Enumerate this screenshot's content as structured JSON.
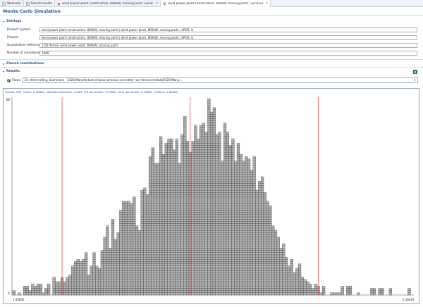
{
  "tabs": [
    {
      "label": "Welcome",
      "icon": "welcome-icon",
      "closable": false
    },
    {
      "label": "Search results",
      "icon": "search-results-icon",
      "closable": false
    },
    {
      "label": "wind power plant construction, 800kW, moving parts | wind power plant, 8...",
      "icon": "process-icon",
      "closable": true
    },
    {
      "label": "wind power plant construction, 800kW, moving parts | wind power plant, 8...",
      "icon": "product-system-icon",
      "closable": true,
      "active": true
    }
  ],
  "page_title": "Monte Carlo Simulation",
  "settings": {
    "header": "Settings",
    "fields": [
      {
        "label": "Product system",
        "value": "wind power plant construction, 800kW, moving parts | wind power plant, 800kW, moving parts | APOS, U"
      },
      {
        "label": "Process",
        "value": "wind power plant construction, 800kW, moving parts | wind power plant, 800kW, moving parts | APOS, U"
      },
      {
        "label": "Quantitative reference",
        "value": "1.00 Item(s) wind power plant, 800kW, moving parts"
      },
      {
        "label": "Number of simulations",
        "value": "1000"
      }
    ]
  },
  "pinned_contributions": {
    "header": "Pinned contributions"
  },
  "results": {
    "header": "Results",
    "radio_label": "Flows",
    "selected_flow": "Zn sheet rolling, aluminium - 2424:Manufacture of basic precious and other non-ferrous metals/2420:Manu...",
    "excel_icon_label": "X"
  },
  "chart_data": {
    "type": "histogram",
    "stats": {
      "results": "999",
      "mean": "2.05662",
      "standard_deviation": "0.463",
      "p5": "1.97662",
      "p95": "2.13862",
      "median": "2.05662"
    },
    "stats_labels": {
      "results": "results:",
      "mean": "mean:",
      "standard_deviation": "standard deviation:",
      "p5": "5% percentile:",
      "p95": "95% percentile:",
      "median": "median:"
    },
    "y_tick_top": "88",
    "y_tick_bottom": "0",
    "x_tick_left": "1.93802",
    "x_tick_right": "2.16403",
    "y_max": 88,
    "counts": [
      2,
      0,
      1,
      0,
      4,
      4,
      2,
      5,
      4,
      5,
      5,
      1,
      3,
      5,
      0,
      8,
      6,
      6,
      8,
      6,
      8,
      9,
      13,
      15,
      16,
      15,
      16,
      19,
      9,
      13,
      19,
      13,
      12,
      20,
      26,
      31,
      21,
      34,
      25,
      28,
      38,
      42,
      42,
      42,
      41,
      44,
      31,
      29,
      47,
      48,
      45,
      62,
      66,
      59,
      59,
      71,
      63,
      68,
      70,
      70,
      65,
      70,
      59,
      72,
      80,
      69,
      64,
      69,
      76,
      70,
      76,
      77,
      73,
      88,
      82,
      84,
      72,
      73,
      60,
      77,
      73,
      67,
      70,
      60,
      68,
      63,
      60,
      62,
      61,
      56,
      62,
      47,
      51,
      53,
      46,
      42,
      40,
      31,
      29,
      26,
      21,
      23,
      17,
      13,
      16,
      10,
      12,
      14,
      8,
      7,
      6,
      5,
      3,
      5,
      4,
      1,
      4,
      0,
      0,
      1,
      1,
      1,
      1,
      4,
      0,
      4,
      4,
      0,
      0,
      1,
      0,
      0,
      0,
      0,
      3,
      3,
      0,
      3,
      3,
      0,
      0,
      3,
      0,
      0,
      0,
      0,
      0,
      0,
      3,
      0
    ],
    "reference_lines_at_bins": [
      18.5,
      66.5,
      114.5
    ],
    "bar_fill": "#b5b5b5",
    "bar_grid": "#3a3a3a",
    "reference_line_color": "#e03c3c",
    "stats_color": "#2a3fbf"
  }
}
